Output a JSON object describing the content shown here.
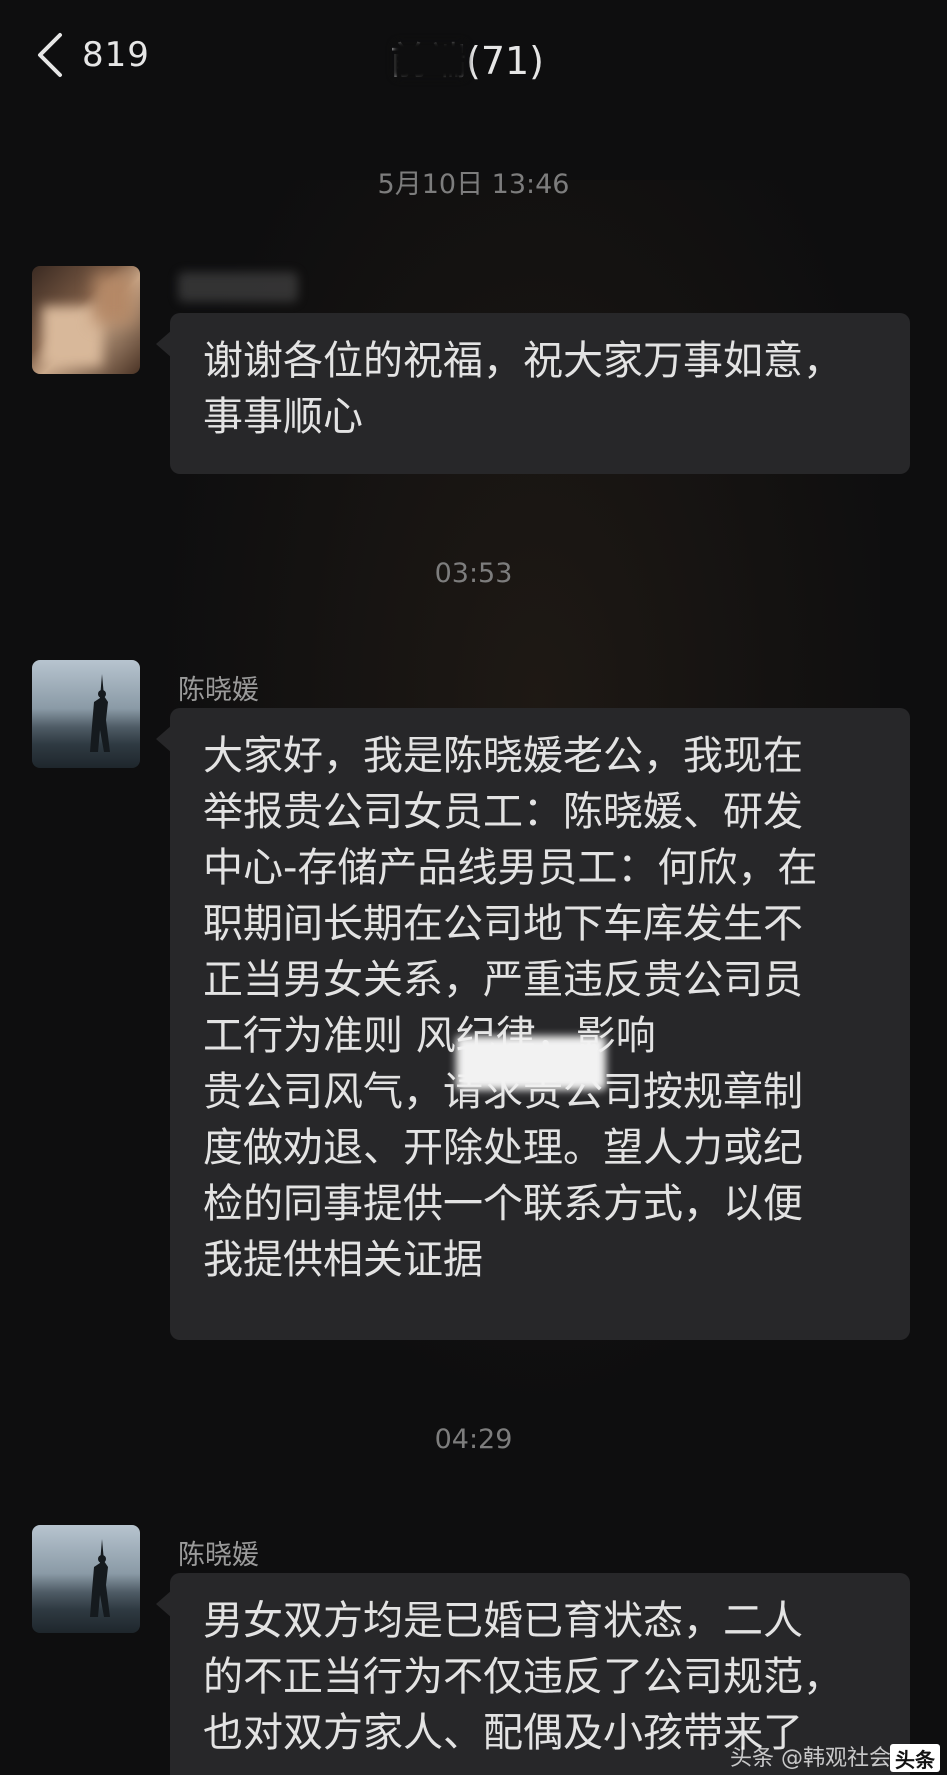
{
  "header": {
    "back_count": "819",
    "title": "前端(71)"
  },
  "messages": [
    {
      "timestamp": "5月10日 13:46",
      "sender": "",
      "text": "谢谢各位的祝福，祝大家万事如意，\n事事顺心"
    },
    {
      "timestamp": "03:53",
      "sender": "陈晓媛",
      "text": "大家好，我是陈晓媛老公，我现在\n举报贵公司女员工：陈晓媛、研发\n中心-存储产品线男员工：何欣，在\n职期间长期在公司地下车库发生不\n正当男女关系，严重违反贵公司员\n工行为准则          风纪律，影响\n贵公司风气，请求贵公司按规章制\n度做劝退、开除处理。望人力或纪\n检的同事提供一个联系方式，以便\n我提供相关证据"
    },
    {
      "timestamp": "04:29",
      "sender": "陈晓媛",
      "text": "男女双方均是已婚已育状态，二人\n的不正当行为不仅违反了公司规范，\n也对双方家人、配偶及小孩带来了"
    }
  ],
  "watermark": {
    "text": "头条 @韩观社会",
    "logo": "头条"
  },
  "colors": {
    "background": "#0e0e0f",
    "bubble": "#272729",
    "timestamp": "#7d7d7d",
    "sender_name": "#9a9a9a",
    "message_text": "#e3e3e3"
  }
}
